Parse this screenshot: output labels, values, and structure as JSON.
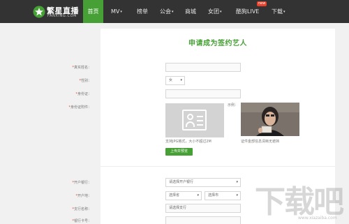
{
  "nav": {
    "logo_title": "繁星直播",
    "logo_subtitle": "FANXING.COM",
    "items": [
      {
        "label": "首页"
      },
      {
        "label": "MV",
        "caret": "▾"
      },
      {
        "label": "榜单"
      },
      {
        "label": "公会",
        "caret": "▾"
      },
      {
        "label": "商城"
      },
      {
        "label": "女团",
        "caret": "▾"
      },
      {
        "label": "酷狗LIVE",
        "badge": "new"
      },
      {
        "label": "下载",
        "caret": "▾"
      }
    ],
    "active_index": 0
  },
  "form": {
    "title": "申请成为签约艺人",
    "real_name_label": "真实姓名：",
    "gender_label": "性别：",
    "gender_value": "女",
    "id_number_label": "身份证：",
    "id_photo_label": "身份证附件：",
    "sample_label": "示例：",
    "format_hint": "支持JPG格式，大小不超过2M",
    "sample_hint": "证件金部信息清晰无遮挡",
    "upload_button": "上传并预览",
    "bank_label": "开户银行：",
    "bank_placeholder": "请选择开户银行",
    "area_label": "开户地：",
    "province_placeholder": "选择省",
    "city_placeholder": "选择市",
    "branch_label": "支行名称：",
    "branch_placeholder": "请选择支行",
    "card_label": "银行卡号："
  },
  "watermark": {
    "text": "下载吧",
    "url": "www.xiazaiba.com"
  },
  "colors": {
    "brand_green": "#46a035",
    "nav_bg": "#333333",
    "required_star": "#e8412c"
  }
}
